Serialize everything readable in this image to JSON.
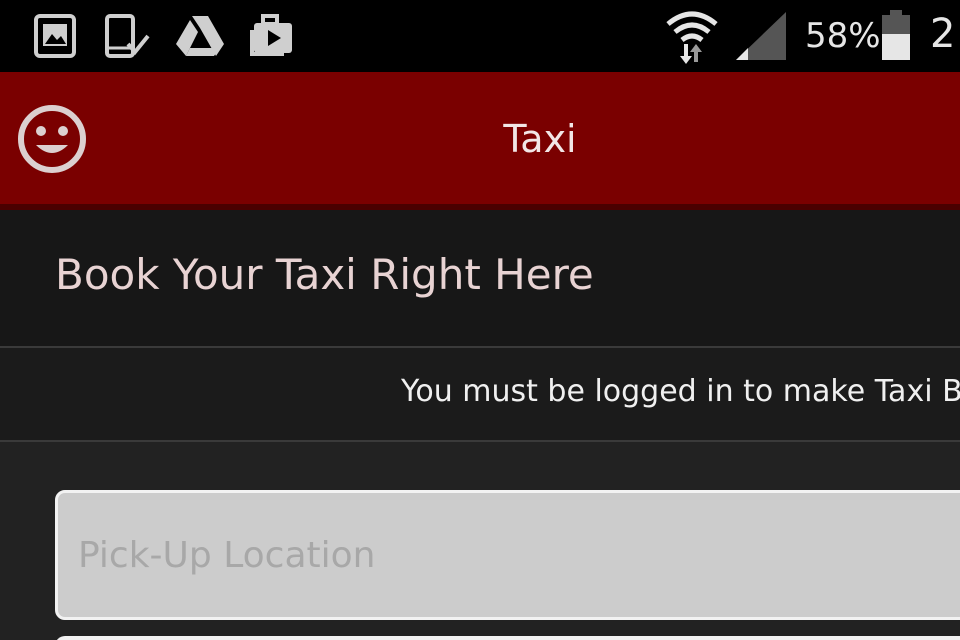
{
  "status_bar": {
    "battery_percent": "58%",
    "clock_partial": "2",
    "icons": [
      "gallery-icon",
      "device-check-icon",
      "drive-icon",
      "briefcase-play-icon",
      "wifi-icon",
      "signal-icon",
      "battery-icon"
    ]
  },
  "app_bar": {
    "title": "Taxi",
    "app_icon": "smiley-icon"
  },
  "header": {
    "heading": "Book Your Taxi Right Here"
  },
  "notice": {
    "text": "You must be logged in to make Taxi Book"
  },
  "form": {
    "pickup_placeholder": "Pick-Up Location"
  },
  "colors": {
    "app_bar": "#7a0000",
    "status_bar": "#000000",
    "background": "#222222",
    "heading_text": "#e8d3d3",
    "input_bg": "#cccccc"
  }
}
